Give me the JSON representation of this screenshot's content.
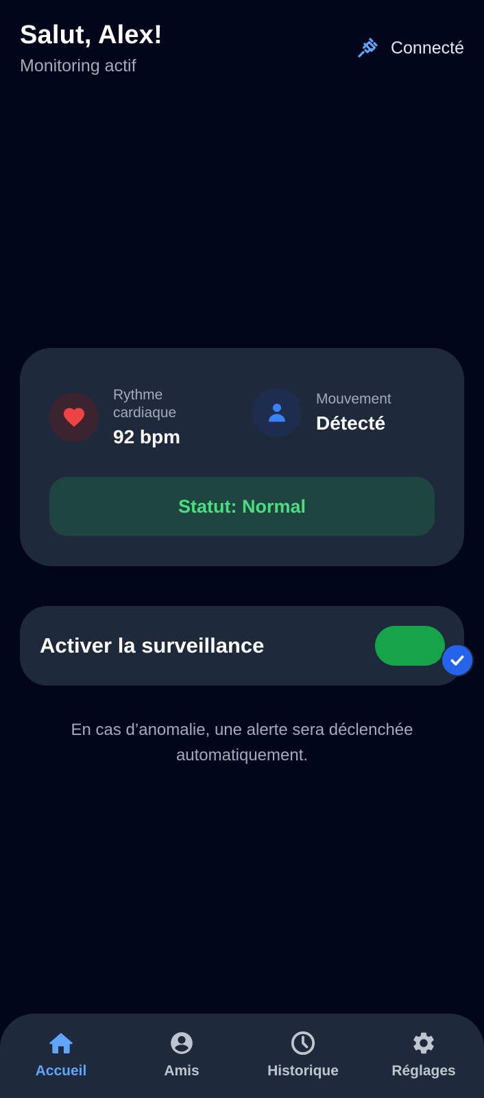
{
  "header": {
    "greeting": "Salut, Alex!",
    "subtitle": "Monitoring actif",
    "connection_status": "Connecté",
    "connection_icon": "plug-icon"
  },
  "vitals": {
    "heart_rate": {
      "label": "Rythme cardiaque",
      "value": "92 bpm",
      "icon": "heart-icon"
    },
    "movement": {
      "label": "Mouvement",
      "value": "Détecté",
      "icon": "person-icon"
    },
    "status": "Statut: Normal"
  },
  "monitoring": {
    "label": "Activer la surveillance",
    "enabled": true
  },
  "info": "En cas d’anomalie, une alerte sera déclenchée automatiquement.",
  "nav": {
    "items": [
      {
        "label": "Accueil",
        "icon": "home-icon",
        "active": true
      },
      {
        "label": "Amis",
        "icon": "account-circle-icon",
        "active": false
      },
      {
        "label": "Historique",
        "icon": "clock-icon",
        "active": false
      },
      {
        "label": "Réglages",
        "icon": "gear-icon",
        "active": false
      }
    ]
  },
  "colors": {
    "background": "#02061a",
    "card": "#1e293b",
    "accent_blue": "#60a5fa",
    "heart_red": "#ef4444",
    "status_green": "#4ade80",
    "toggle_on": "#16a34a",
    "check_blue": "#2563eb"
  }
}
